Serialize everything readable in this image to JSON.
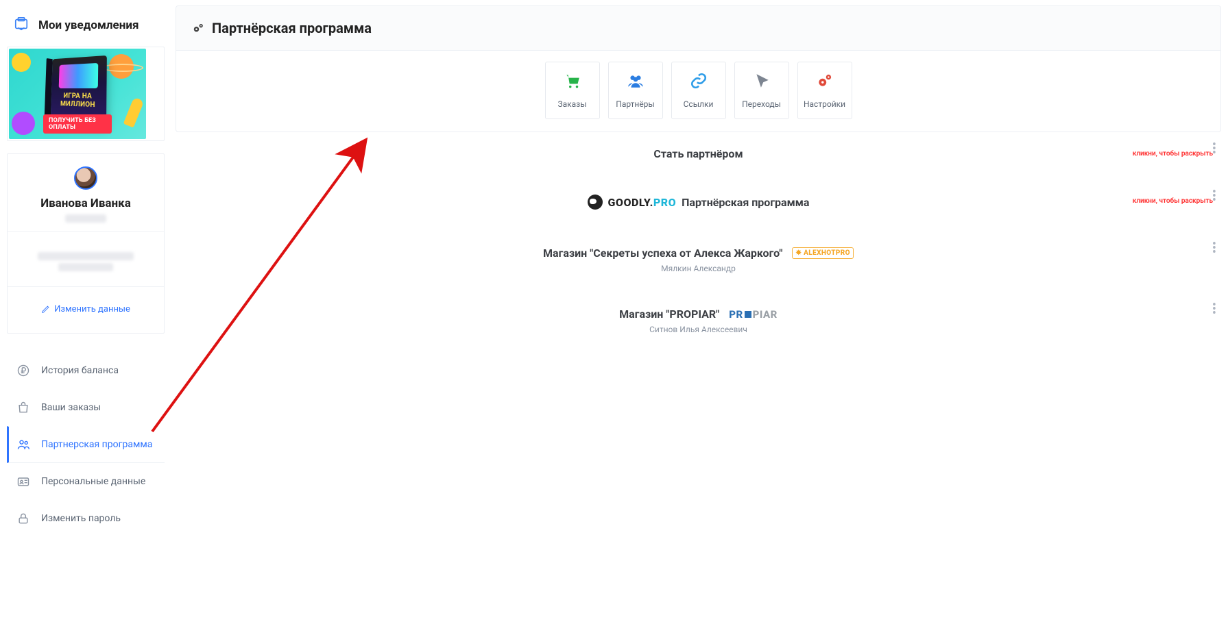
{
  "sidebar": {
    "notifications_title": "Мои уведомления",
    "promo": {
      "box_text": "ИГРА\nНА МИЛЛИОН",
      "button": "ПОЛУЧИТЬ БЕЗ ОПЛАТЫ"
    },
    "profile": {
      "name": "Иванова Иванка",
      "edit_label": "Изменить данные"
    },
    "nav": [
      {
        "id": "balance",
        "label": "История баланса",
        "icon": "ruble-icon"
      },
      {
        "id": "orders",
        "label": "Ваши заказы",
        "icon": "bag-icon"
      },
      {
        "id": "partner",
        "label": "Партнерская программа",
        "icon": "users-icon",
        "active": true
      },
      {
        "id": "personal",
        "label": "Персональные данные",
        "icon": "id-icon"
      },
      {
        "id": "password",
        "label": "Изменить пароль",
        "icon": "lock-icon"
      }
    ]
  },
  "main": {
    "title": "Партнёрская программа",
    "tiles": [
      {
        "id": "orders",
        "label": "Заказы",
        "icon": "cart",
        "color": "ic-green"
      },
      {
        "id": "partners",
        "label": "Партнёры",
        "icon": "users",
        "color": "ic-blue"
      },
      {
        "id": "links",
        "label": "Ссылки",
        "icon": "link",
        "color": "ic-blue2"
      },
      {
        "id": "clicks",
        "label": "Переходы",
        "icon": "cursor",
        "color": "ic-gray"
      },
      {
        "id": "settings",
        "label": "Настройки",
        "icon": "gears",
        "color": "ic-red"
      }
    ],
    "sections": [
      {
        "id": "become_partner",
        "title": "Стать партнёром",
        "hint": "кликни, чтобы раскрыть"
      },
      {
        "id": "goodly",
        "logo": "goodly",
        "title_suffix": " Партнёрская программа",
        "brand_part1": "GOODLY.",
        "brand_part2": "PRO",
        "hint": "кликни, чтобы раскрыть"
      },
      {
        "id": "alex",
        "title": "Магазин \"Секреты успеха от Алекса Жаркого\"",
        "tag": "ALEXHOTPRO",
        "subtitle": "Мялкин Александр"
      },
      {
        "id": "propiar",
        "title": "Магазин \"PROPIAR\"",
        "brand_pr": "PR",
        "brand_piar": "PIAR",
        "subtitle": "Ситнов Илья Алексеевич"
      }
    ]
  }
}
